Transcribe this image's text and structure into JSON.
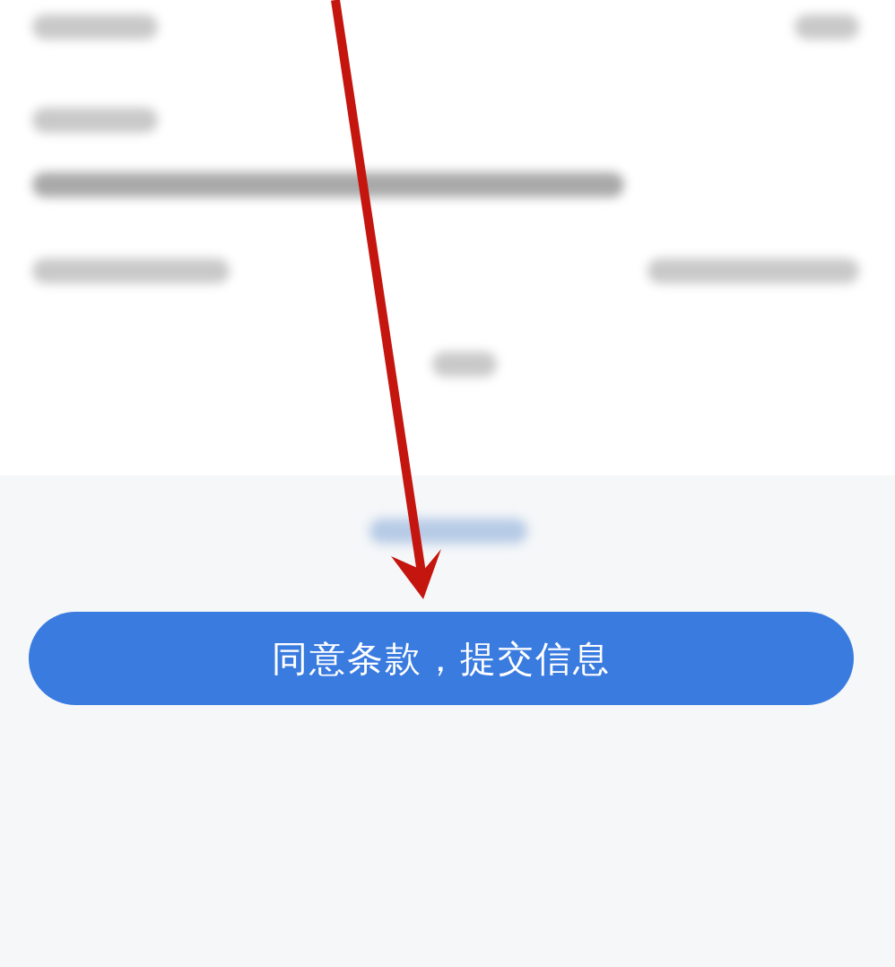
{
  "submit_button": {
    "label": "同意条款，提交信息"
  }
}
